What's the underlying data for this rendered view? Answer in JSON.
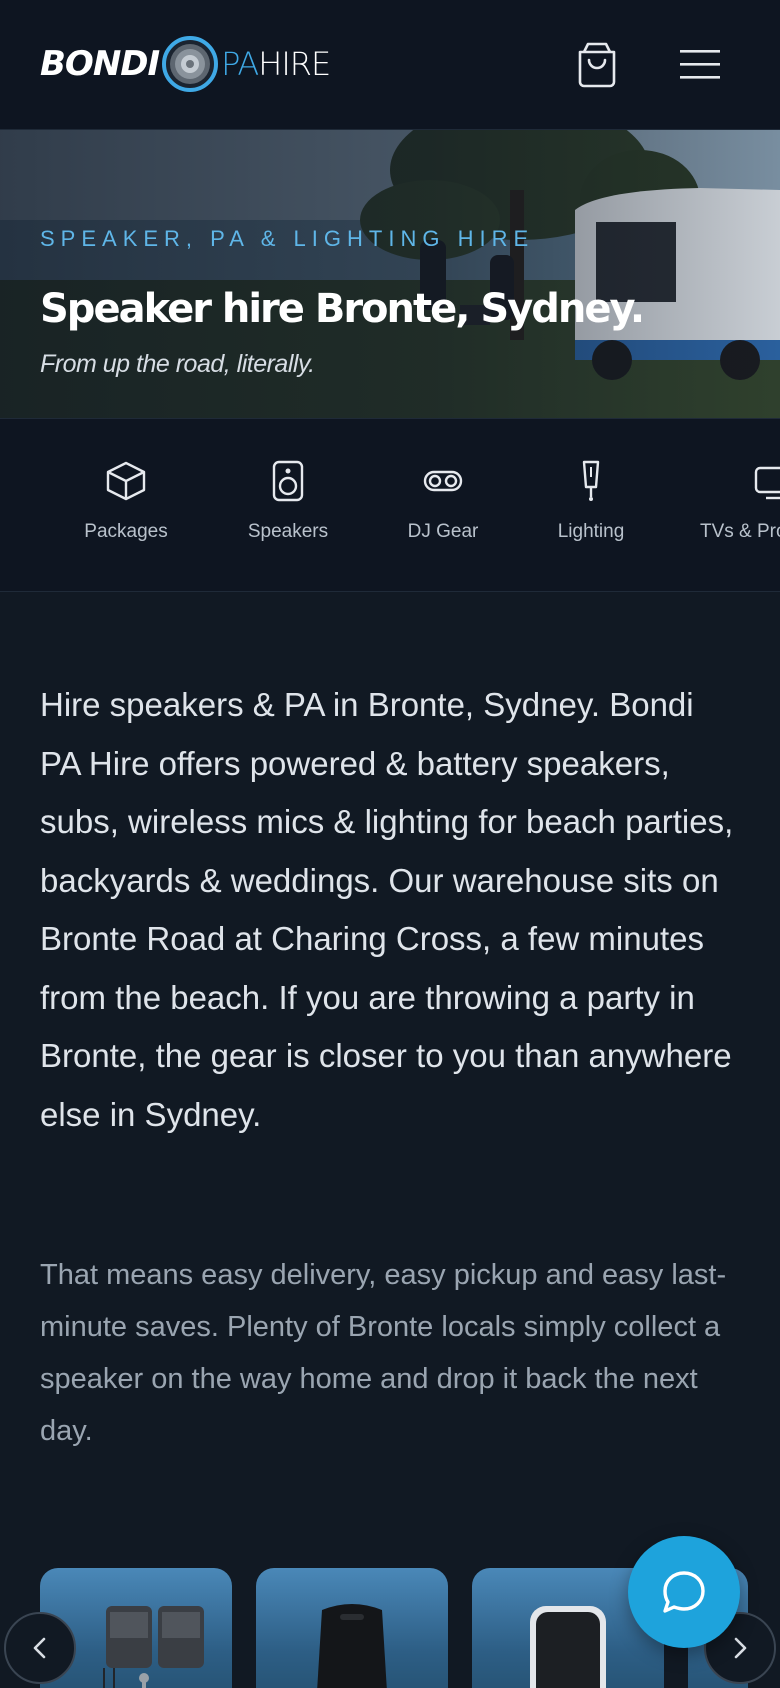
{
  "header": {
    "logo": {
      "part1": "BONDI",
      "part2": "PA",
      "part3": "HIRE"
    },
    "cart_icon": "shopping-bag-icon",
    "menu_icon": "hamburger-menu-icon"
  },
  "hero": {
    "kicker": "SPEAKER, PA & LIGHTING HIRE",
    "title": "Speaker hire Bronte, Sydney.",
    "subtitle": "From up the road, literally."
  },
  "categories": [
    {
      "label": "Packages",
      "icon": "box-icon"
    },
    {
      "label": "Speakers",
      "icon": "speaker-icon"
    },
    {
      "label": "DJ Gear",
      "icon": "dj-gear-icon"
    },
    {
      "label": "Lighting",
      "icon": "light-icon"
    },
    {
      "label": "TVs & Projectors",
      "icon": "tv-icon"
    }
  ],
  "content": {
    "lead": "Hire speakers & PA in Bronte, Sydney. Bondi PA Hire offers powered & battery speakers, subs, wireless mics & lighting for beach parties, backyards & weddings. Our warehouse sits on Bronte Road at Charing Cross, a few minutes from the beach. If you are throwing a party in Bronte, the gear is closer to you than anywhere else in Sydney.",
    "body": "That means easy delivery, easy pickup and easy last-minute saves. Plenty of Bronte locals simply collect a speaker on the way home and drop it back the next day."
  },
  "carousel": {
    "prev_icon": "chevron-left-icon",
    "next_icon": "chevron-right-icon",
    "chat_icon": "chat-bubble-icon"
  },
  "colors": {
    "background": "#111923",
    "header": "#0e1521",
    "accent": "#3fa9e6",
    "chat": "#1ea3dc"
  }
}
